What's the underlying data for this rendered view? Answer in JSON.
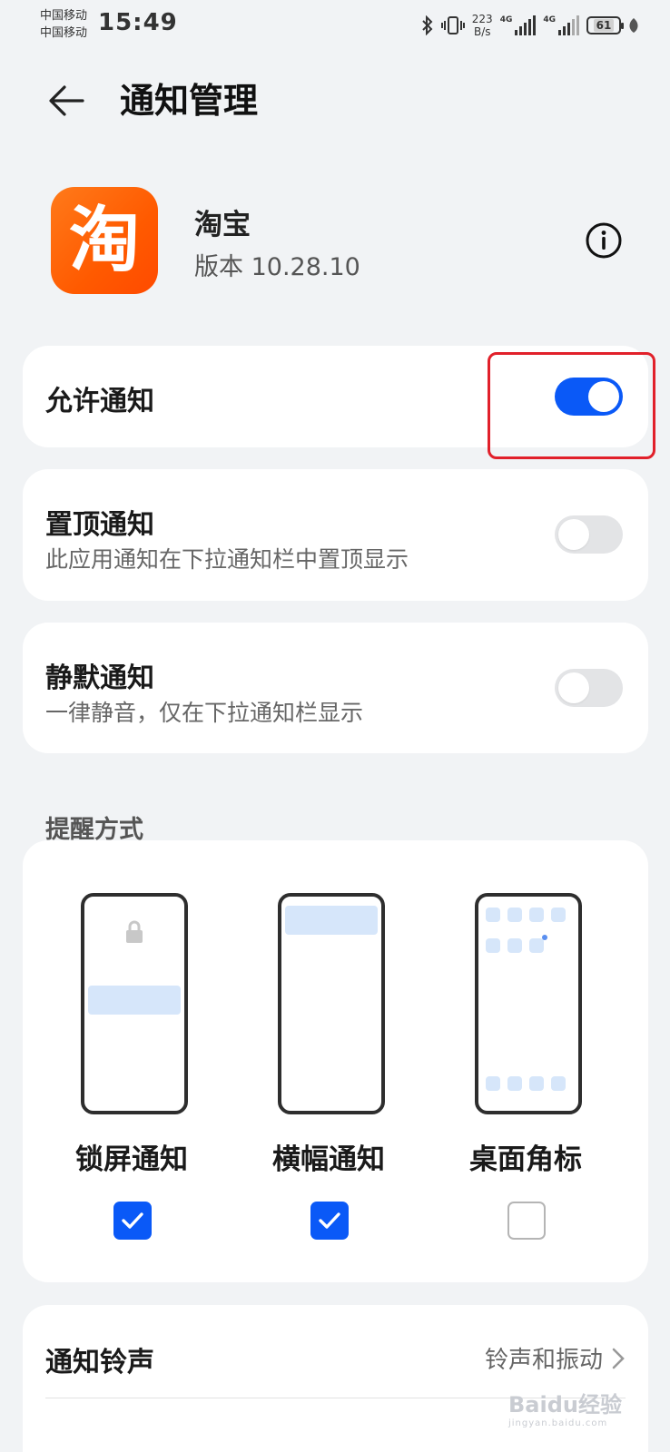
{
  "status_bar": {
    "carrier_1": "中国移动",
    "carrier_2": "中国移动",
    "time": "15:49",
    "net_speed_value": "223",
    "net_speed_unit": "B/s",
    "network_1": "4G",
    "network_2": "4G",
    "battery": "61"
  },
  "header": {
    "title": "通知管理",
    "back_icon": "arrow-left-icon"
  },
  "app": {
    "icon_glyph": "淘",
    "icon_color": "#ff5a00",
    "name": "淘宝",
    "version": "版本 10.28.10",
    "info_icon": "info-icon"
  },
  "allow_notifications": {
    "label": "允许通知",
    "enabled": true
  },
  "pinned_notifications": {
    "label": "置顶通知",
    "description": "此应用通知在下拉通知栏中置顶显示",
    "enabled": false
  },
  "silent_notifications": {
    "label": "静默通知",
    "description": "一律静音，仅在下拉通知栏显示",
    "enabled": false
  },
  "reminder_section": {
    "label": "提醒方式",
    "modes": [
      {
        "label": "锁屏通知",
        "checked": true
      },
      {
        "label": "横幅通知",
        "checked": true
      },
      {
        "label": "桌面角标",
        "checked": false
      }
    ]
  },
  "ringtone": {
    "label": "通知铃声",
    "value": "铃声和振动"
  },
  "colors": {
    "accent": "#0a59f7",
    "highlight": "#e1202a",
    "background": "#f1f3f5"
  },
  "watermark": {
    "brand": "Baidu经验",
    "site": "jingyan.baidu.com"
  }
}
